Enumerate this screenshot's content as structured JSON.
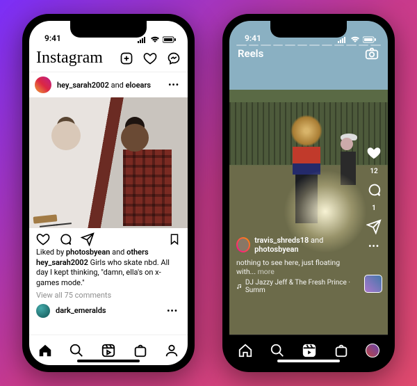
{
  "status": {
    "time": "9:41"
  },
  "feed": {
    "logo": "Instagram",
    "post_user1": "hey_sarah2002",
    "post_sep": " and ",
    "post_user2": "eloears",
    "liked_prefix": "Liked by ",
    "liked_user": "photosbyean",
    "liked_suffix": " and ",
    "liked_others": "others",
    "caption_user": "hey_sarah2002",
    "caption_text": " Girls who skate nbd. All day I kept thinking, \"damn, ella's on x-games mode.\"",
    "view_comments": "View all 75 comments",
    "next_commenter": "dark_emeralds"
  },
  "reels": {
    "title": "Reels",
    "like_count": "12",
    "comment_count": "1",
    "user1": "travis_shreds18",
    "sep": " and ",
    "user2": "photosbyean",
    "caption": "nothing to see here, just floating with... ",
    "more": "more",
    "music_prefix": "DJ Jazzy Jeff & The Fresh Prince · Summ"
  }
}
